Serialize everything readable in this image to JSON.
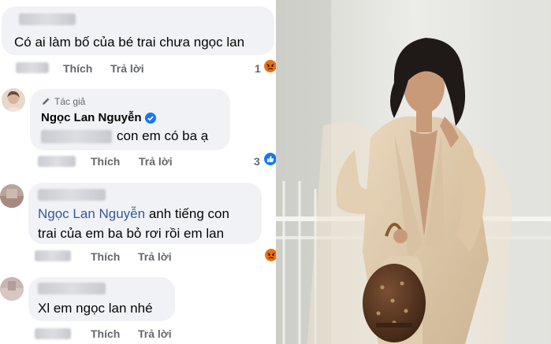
{
  "comments": [
    {
      "text": "Có ai làm bố của bé trai chưa ngọc lan",
      "like_label": "Thích",
      "reply_label": "Trả lời",
      "reaction_count": "1",
      "reaction_icon": "angry-reaction-icon"
    },
    {
      "author_badge": "Tác giả",
      "author_name": "Ngọc Lan Nguyễn",
      "text": "con em có ba ạ",
      "like_label": "Thích",
      "reply_label": "Trả lời",
      "reaction_count": "3",
      "reaction_icon": "like-reaction-icon"
    },
    {
      "mention": "Ngọc Lan Nguyễn",
      "text_line1": " anh tiếng con",
      "text_line2": "trai của em ba bỏ rơi rồi em lan",
      "like_label": "Thích",
      "reply_label": "Trả lời",
      "reaction_icon": "angry-reaction-icon"
    },
    {
      "text": "Xl em ngọc lan nhé",
      "like_label": "Thích",
      "reply_label": "Trả lời"
    }
  ],
  "colors": {
    "bubble": "#f0f2f5",
    "meta_text": "#65676b",
    "mention": "#385898",
    "verified": "#1877f2"
  }
}
